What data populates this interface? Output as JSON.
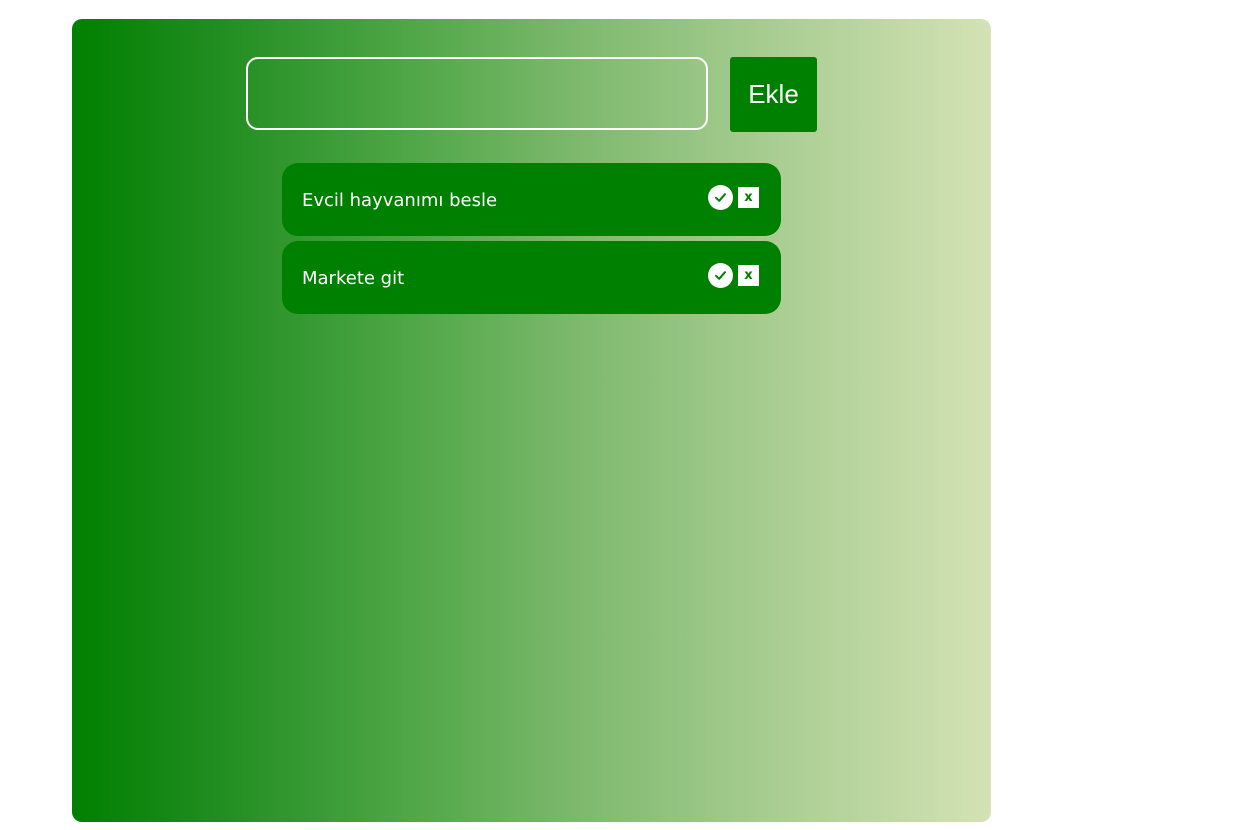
{
  "form": {
    "input_value": "",
    "add_label": "Ekle"
  },
  "todos": [
    {
      "text": "Evcil hayvanımı besle",
      "complete_icon": "check-icon",
      "delete_label": "x"
    },
    {
      "text": "Markete git",
      "complete_icon": "check-icon",
      "delete_label": "x"
    }
  ],
  "colors": {
    "accent": "#008000",
    "gradient_end": "#d4e2b4",
    "text": "#ffffff"
  }
}
